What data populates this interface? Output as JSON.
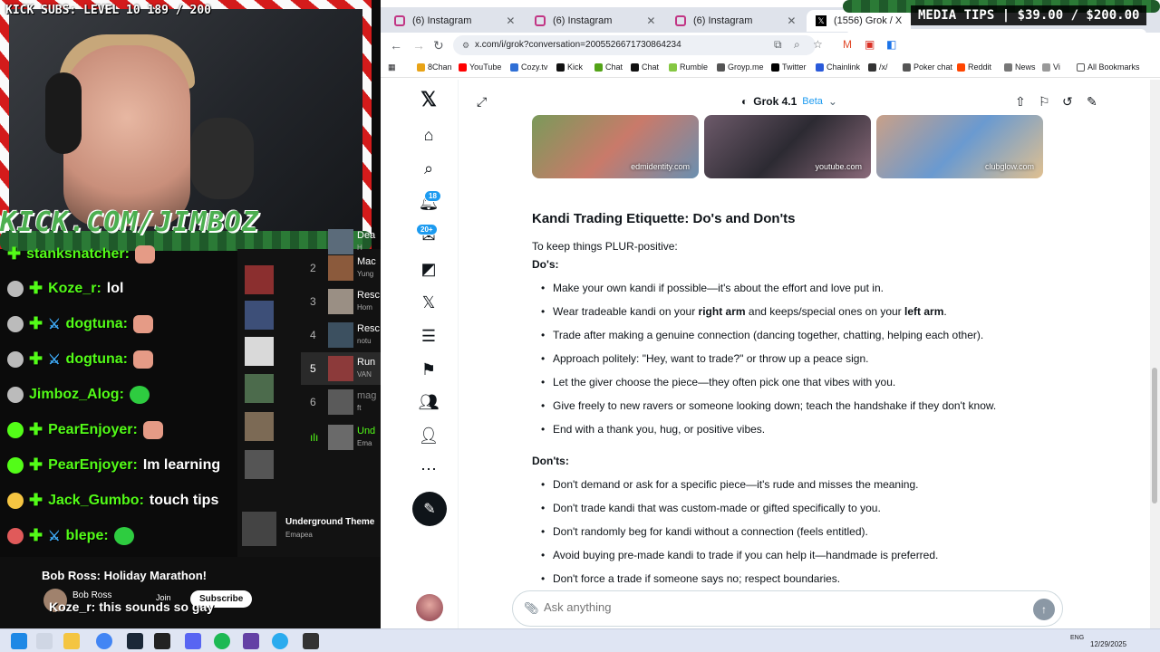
{
  "stream": {
    "kick_subs": "KICK SUBS: LEVEL 10 189 / 200",
    "kick_url": "KICK.COM/JIMBOZ",
    "media_tips": "MEDIA TIPS | $39.00 / $200.00",
    "chat": [
      {
        "user": "stanksnatcher:",
        "msg": ""
      },
      {
        "user": "Koze_r:",
        "msg": "lol"
      },
      {
        "user": "dogtuna:",
        "msg": ""
      },
      {
        "user": "dogtuna:",
        "msg": ""
      },
      {
        "user": "Jimboz_Alog:",
        "msg": ""
      },
      {
        "user": "PearEnjoyer:",
        "msg": ""
      },
      {
        "user": "PearEnjoyer:",
        "msg": "Im learning"
      },
      {
        "user": "Jack_Gumbo:",
        "msg": "touch tips"
      },
      {
        "user": "blepe:",
        "msg": ""
      }
    ],
    "overlay_line": "Koze_r: this sounds so gay",
    "music": {
      "tracks": [
        {
          "num": "",
          "title": "Dea",
          "sub": "H"
        },
        {
          "num": "2",
          "title": "Mac",
          "sub": "Yung"
        },
        {
          "num": "3",
          "title": "Resc",
          "sub": "Hom"
        },
        {
          "num": "4",
          "title": "Resc",
          "sub": "notu"
        },
        {
          "num": "5",
          "title": "Run",
          "sub": "VAN"
        },
        {
          "num": "6",
          "title": "mag",
          "sub": "ft"
        },
        {
          "num": "",
          "title": "Und",
          "sub": "Ema"
        }
      ],
      "underground_title": "Underground Theme",
      "underground_sub": "Emapea"
    },
    "youtube": {
      "title": "Bob Ross: Holiday Marathon!",
      "channel": "Bob Ross",
      "join": "Join",
      "subscribe": "Subscribe"
    }
  },
  "browser": {
    "tabs": [
      {
        "label": "(6) Instagram"
      },
      {
        "label": "(6) Instagram"
      },
      {
        "label": "(6) Instagram"
      },
      {
        "label": "(1556) Grok / X"
      }
    ],
    "url": "x.com/i/grok?conversation=2005526671730864234",
    "bookmarks": [
      "8Chan",
      "YouTube",
      "Cozy.tv",
      "Kick",
      "Chat",
      "Chat",
      "Rumble",
      "Groyp.me",
      "Twitter",
      "Chainlink",
      "/x/",
      "Poker chat",
      "Reddit",
      "News",
      "Vi",
      "All Bookmarks"
    ]
  },
  "x": {
    "notif_badge": "18",
    "msg_badge": "20+"
  },
  "grok": {
    "model": "Grok 4.1",
    "beta": "Beta",
    "images": [
      "edmidentity.com",
      "youtube.com",
      "clubglow.com"
    ],
    "heading": "Kandi Trading Etiquette: Do's and Don'ts",
    "intro": "To keep things PLUR-positive:",
    "dos_label": "Do's",
    "dos": [
      {
        "pre": "Make your own kandi if possible—it's about the effort and love put in.",
        "b1": "",
        "mid": "",
        "b2": "",
        "post": ""
      },
      {
        "pre": "Wear tradeable kandi on your ",
        "b1": "right arm",
        "mid": " and keeps/special ones on your ",
        "b2": "left arm",
        "post": "."
      },
      {
        "pre": "Trade after making a genuine connection (dancing together, chatting, helping each other).",
        "b1": "",
        "mid": "",
        "b2": "",
        "post": ""
      },
      {
        "pre": "Approach politely: \"Hey, want to trade?\" or throw up a peace sign.",
        "b1": "",
        "mid": "",
        "b2": "",
        "post": ""
      },
      {
        "pre": "Let the giver choose the piece—they often pick one that vibes with you.",
        "b1": "",
        "mid": "",
        "b2": "",
        "post": ""
      },
      {
        "pre": "Give freely to new ravers or someone looking down; teach the handshake if they don't know.",
        "b1": "",
        "mid": "",
        "b2": "",
        "post": ""
      },
      {
        "pre": "End with a thank you, hug, or positive vibes.",
        "b1": "",
        "mid": "",
        "b2": "",
        "post": ""
      }
    ],
    "donts_label": "Don'ts",
    "donts": [
      "Don't demand or ask for a specific piece—it's rude and misses the meaning.",
      "Don't trade kandi that was custom-made or gifted specifically to you.",
      "Don't randomly beg for kandi without a connection (feels entitled).",
      "Avoid buying pre-made kandi to trade if you can help it—handmade is preferred.",
      "Don't force a trade if someone says no; respect boundaries."
    ],
    "ask_placeholder": "Ask anything"
  },
  "taskbar": {
    "lang": "ENG",
    "date": "12/29/2025"
  }
}
